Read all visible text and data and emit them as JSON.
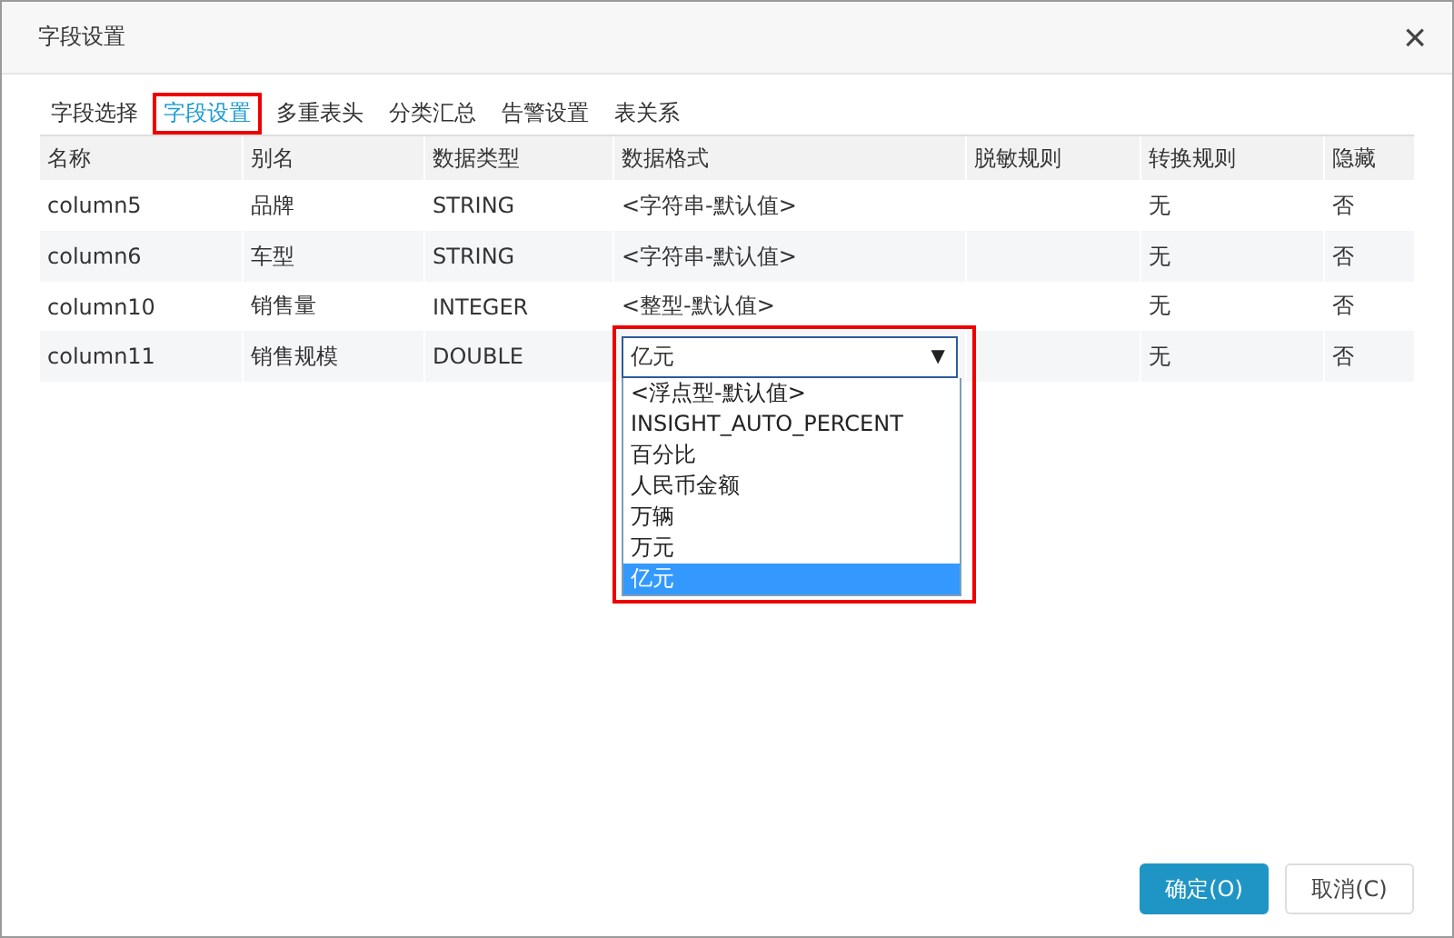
{
  "dialog": {
    "title": "字段设置",
    "close": "×"
  },
  "tabs": [
    {
      "label": "字段选择",
      "selected": false,
      "highlighted": false
    },
    {
      "label": "字段设置",
      "selected": true,
      "highlighted": true
    },
    {
      "label": "多重表头",
      "selected": false,
      "highlighted": false
    },
    {
      "label": "分类汇总",
      "selected": false,
      "highlighted": false
    },
    {
      "label": "告警设置",
      "selected": false,
      "highlighted": false
    },
    {
      "label": "表关系",
      "selected": false,
      "highlighted": false
    }
  ],
  "table": {
    "columns": [
      "名称",
      "别名",
      "数据类型",
      "数据格式",
      "脱敏规则",
      "转换规则",
      "隐藏"
    ],
    "rows": [
      {
        "name": "column5",
        "alias": "品牌",
        "type": "STRING",
        "format": {
          "kind": "text",
          "value": "<字符串-默认值>"
        },
        "convert": "无",
        "hidden": "否"
      },
      {
        "name": "column6",
        "alias": "车型",
        "type": "STRING",
        "format": {
          "kind": "text",
          "value": "<字符串-默认值>"
        },
        "convert": "无",
        "hidden": "否"
      },
      {
        "name": "column10",
        "alias": "销售量",
        "type": "INTEGER",
        "format": {
          "kind": "text",
          "value": "<整型-默认值>"
        },
        "convert": "无",
        "hidden": "否"
      },
      {
        "name": "column11",
        "alias": "销售规模",
        "type": "DOUBLE",
        "format": {
          "kind": "select",
          "value": "亿元",
          "arrow": "▼",
          "highlighted": true,
          "options": [
            {
              "label": "<浮点型-默认值>",
              "selected": false
            },
            {
              "label": "INSIGHT_AUTO_PERCENT",
              "selected": false
            },
            {
              "label": "百分比",
              "selected": false
            },
            {
              "label": "人民币金额",
              "selected": false
            },
            {
              "label": "万辆",
              "selected": false
            },
            {
              "label": "万元",
              "selected": false
            },
            {
              "label": "亿元",
              "selected": true
            }
          ]
        },
        "convert": "无",
        "hidden": "否"
      }
    ]
  },
  "buttons": [
    {
      "label": "确定(O)",
      "kind": "primary"
    },
    {
      "label": "取消(C)",
      "kind": "secondary"
    }
  ]
}
